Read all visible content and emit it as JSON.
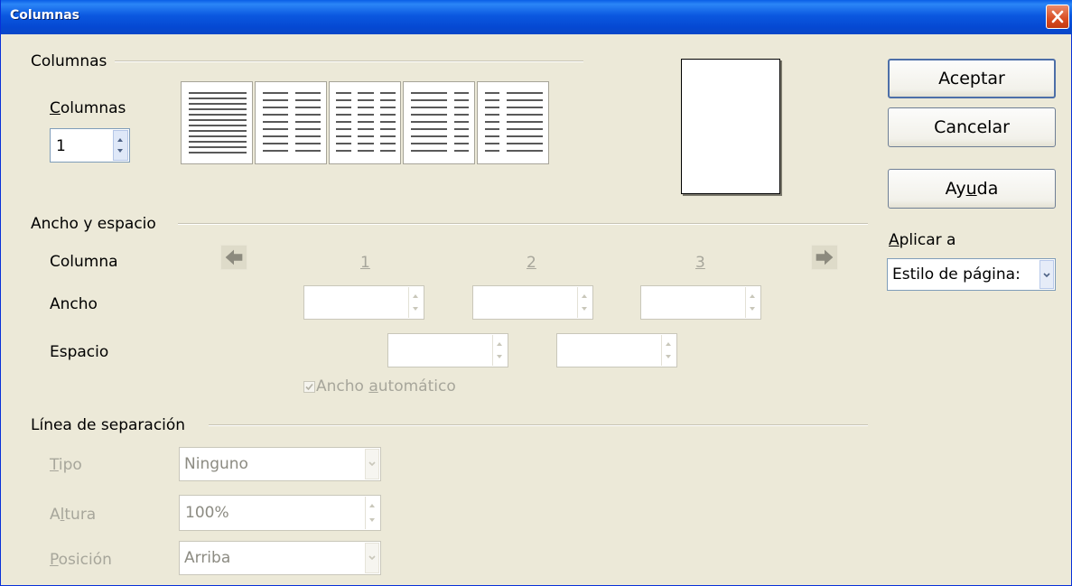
{
  "window": {
    "title": "Columnas"
  },
  "sections": {
    "columns_heading": "Columnas",
    "width_heading": "Ancho y espacio",
    "separator_heading": "Línea de separación"
  },
  "columns": {
    "label_prefix": "C",
    "label_rest": "olumnas",
    "value": "1"
  },
  "width_spacing": {
    "column_label": "Columna",
    "width_label": "Ancho",
    "spacing_label": "Espacio",
    "col_numbers": [
      "1",
      "2",
      "3"
    ],
    "width_values": [
      "",
      "",
      ""
    ],
    "spacing_values": [
      "",
      ""
    ],
    "autowidth_label_a": "Ancho ",
    "autowidth_label_u": "a",
    "autowidth_label_b": "utomático",
    "autowidth_checked": true
  },
  "separator": {
    "type_label_u": "T",
    "type_label_rest": "ipo",
    "type_value": "Ninguno",
    "height_label_a": "A",
    "height_label_u": "l",
    "height_label_rest": "tura",
    "height_value": "100%",
    "position_label_u": "P",
    "position_label_rest": "osición",
    "position_value": "Arriba"
  },
  "buttons": {
    "ok": "Aceptar",
    "cancel": "Cancelar",
    "help_a": "Ay",
    "help_u": "u",
    "help_b": "da"
  },
  "apply_to": {
    "label_u": "A",
    "label_rest": "plicar a",
    "value": "Estilo de página:"
  },
  "icons": {
    "close": "close-icon",
    "prev": "arrow-left-icon",
    "next": "arrow-right-icon"
  },
  "colors": {
    "titlebar": "#0a5ee6",
    "dialog_bg": "#ece9d8",
    "close_button": "#d94d23",
    "disabled_text": "#a7a69b"
  }
}
